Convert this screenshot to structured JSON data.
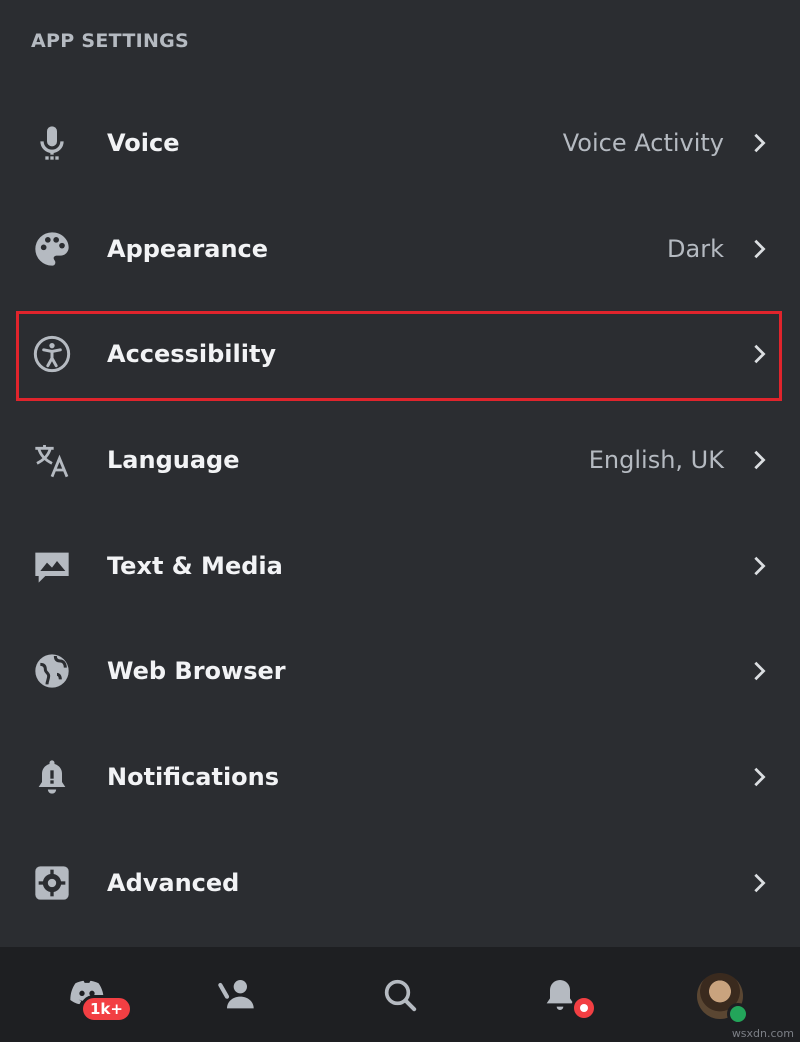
{
  "section": {
    "title": "APP SETTINGS"
  },
  "rows": [
    {
      "key": "voice",
      "label": "Voice",
      "value": "Voice Activity",
      "icon": "microphone-icon"
    },
    {
      "key": "appearance",
      "label": "Appearance",
      "value": "Dark",
      "icon": "palette-icon"
    },
    {
      "key": "accessibility",
      "label": "Accessibility",
      "value": "",
      "icon": "accessibility-icon"
    },
    {
      "key": "language",
      "label": "Language",
      "value": "English, UK",
      "icon": "translate-icon"
    },
    {
      "key": "text-media",
      "label": "Text & Media",
      "value": "",
      "icon": "image-icon"
    },
    {
      "key": "web-browser",
      "label": "Web Browser",
      "value": "",
      "icon": "globe-icon"
    },
    {
      "key": "notifications",
      "label": "Notifications",
      "value": "",
      "icon": "bell-icon"
    },
    {
      "key": "advanced",
      "label": "Advanced",
      "value": "",
      "icon": "gear-icon"
    }
  ],
  "tabbar": {
    "home_badge": "1k+",
    "tabs": [
      "discord-home-icon",
      "friends-icon",
      "search-icon",
      "notifications-bell-icon",
      "profile-avatar"
    ]
  },
  "watermark": "wsxdn.com",
  "colors": {
    "background": "#2b2d31",
    "tabbar": "#1e1f22",
    "highlight": "#e0242c",
    "badge": "#f23f43",
    "online": "#23a55a"
  }
}
